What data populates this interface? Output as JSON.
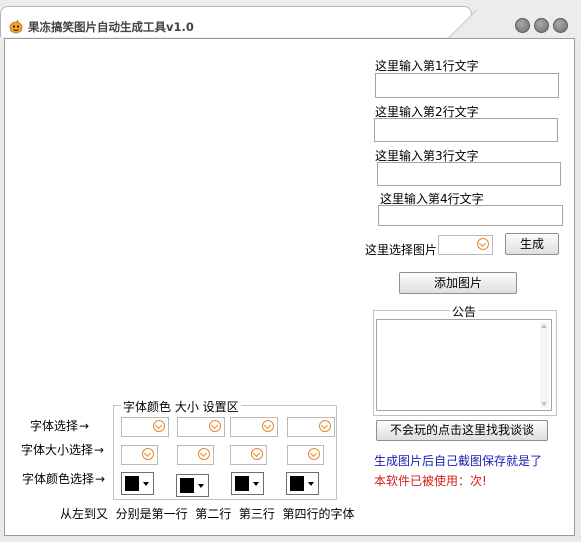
{
  "window": {
    "title": "果冻搞笑图片自动生成工具v1.0",
    "controls": [
      "minimize-icon",
      "maximize-icon",
      "close-icon"
    ]
  },
  "inputs": {
    "line_labels": [
      "这里输入第1行文字",
      "这里输入第2行文字",
      "这里输入第3行文字",
      "这里输入第4行文字"
    ],
    "line_values": [
      "",
      "",
      "",
      ""
    ]
  },
  "image_select": {
    "label": "这里选择图片",
    "value": "",
    "generate_button": "生成",
    "add_button": "添加图片"
  },
  "notice": {
    "title": "公告",
    "text": "",
    "help_button": "不会玩的点击这里找我谈谈",
    "info_line": "生成图片后自己截图保存就是了",
    "usage_line": "本软件已被使用：次!"
  },
  "settings": {
    "group_title": "字体颜色 大小 设置区",
    "font_label": "字体选择",
    "size_label": "字体大小选择",
    "color_label": "字体颜色选择",
    "arrow_glyph": "→",
    "footer": "从左到又  分别是第一行  第二行  第三行  第四行的字体",
    "font_values": [
      "",
      "",
      "",
      ""
    ],
    "size_values": [
      "",
      "",
      "",
      ""
    ],
    "colors": [
      "#000000",
      "#000000",
      "#000000",
      "#000000"
    ]
  }
}
